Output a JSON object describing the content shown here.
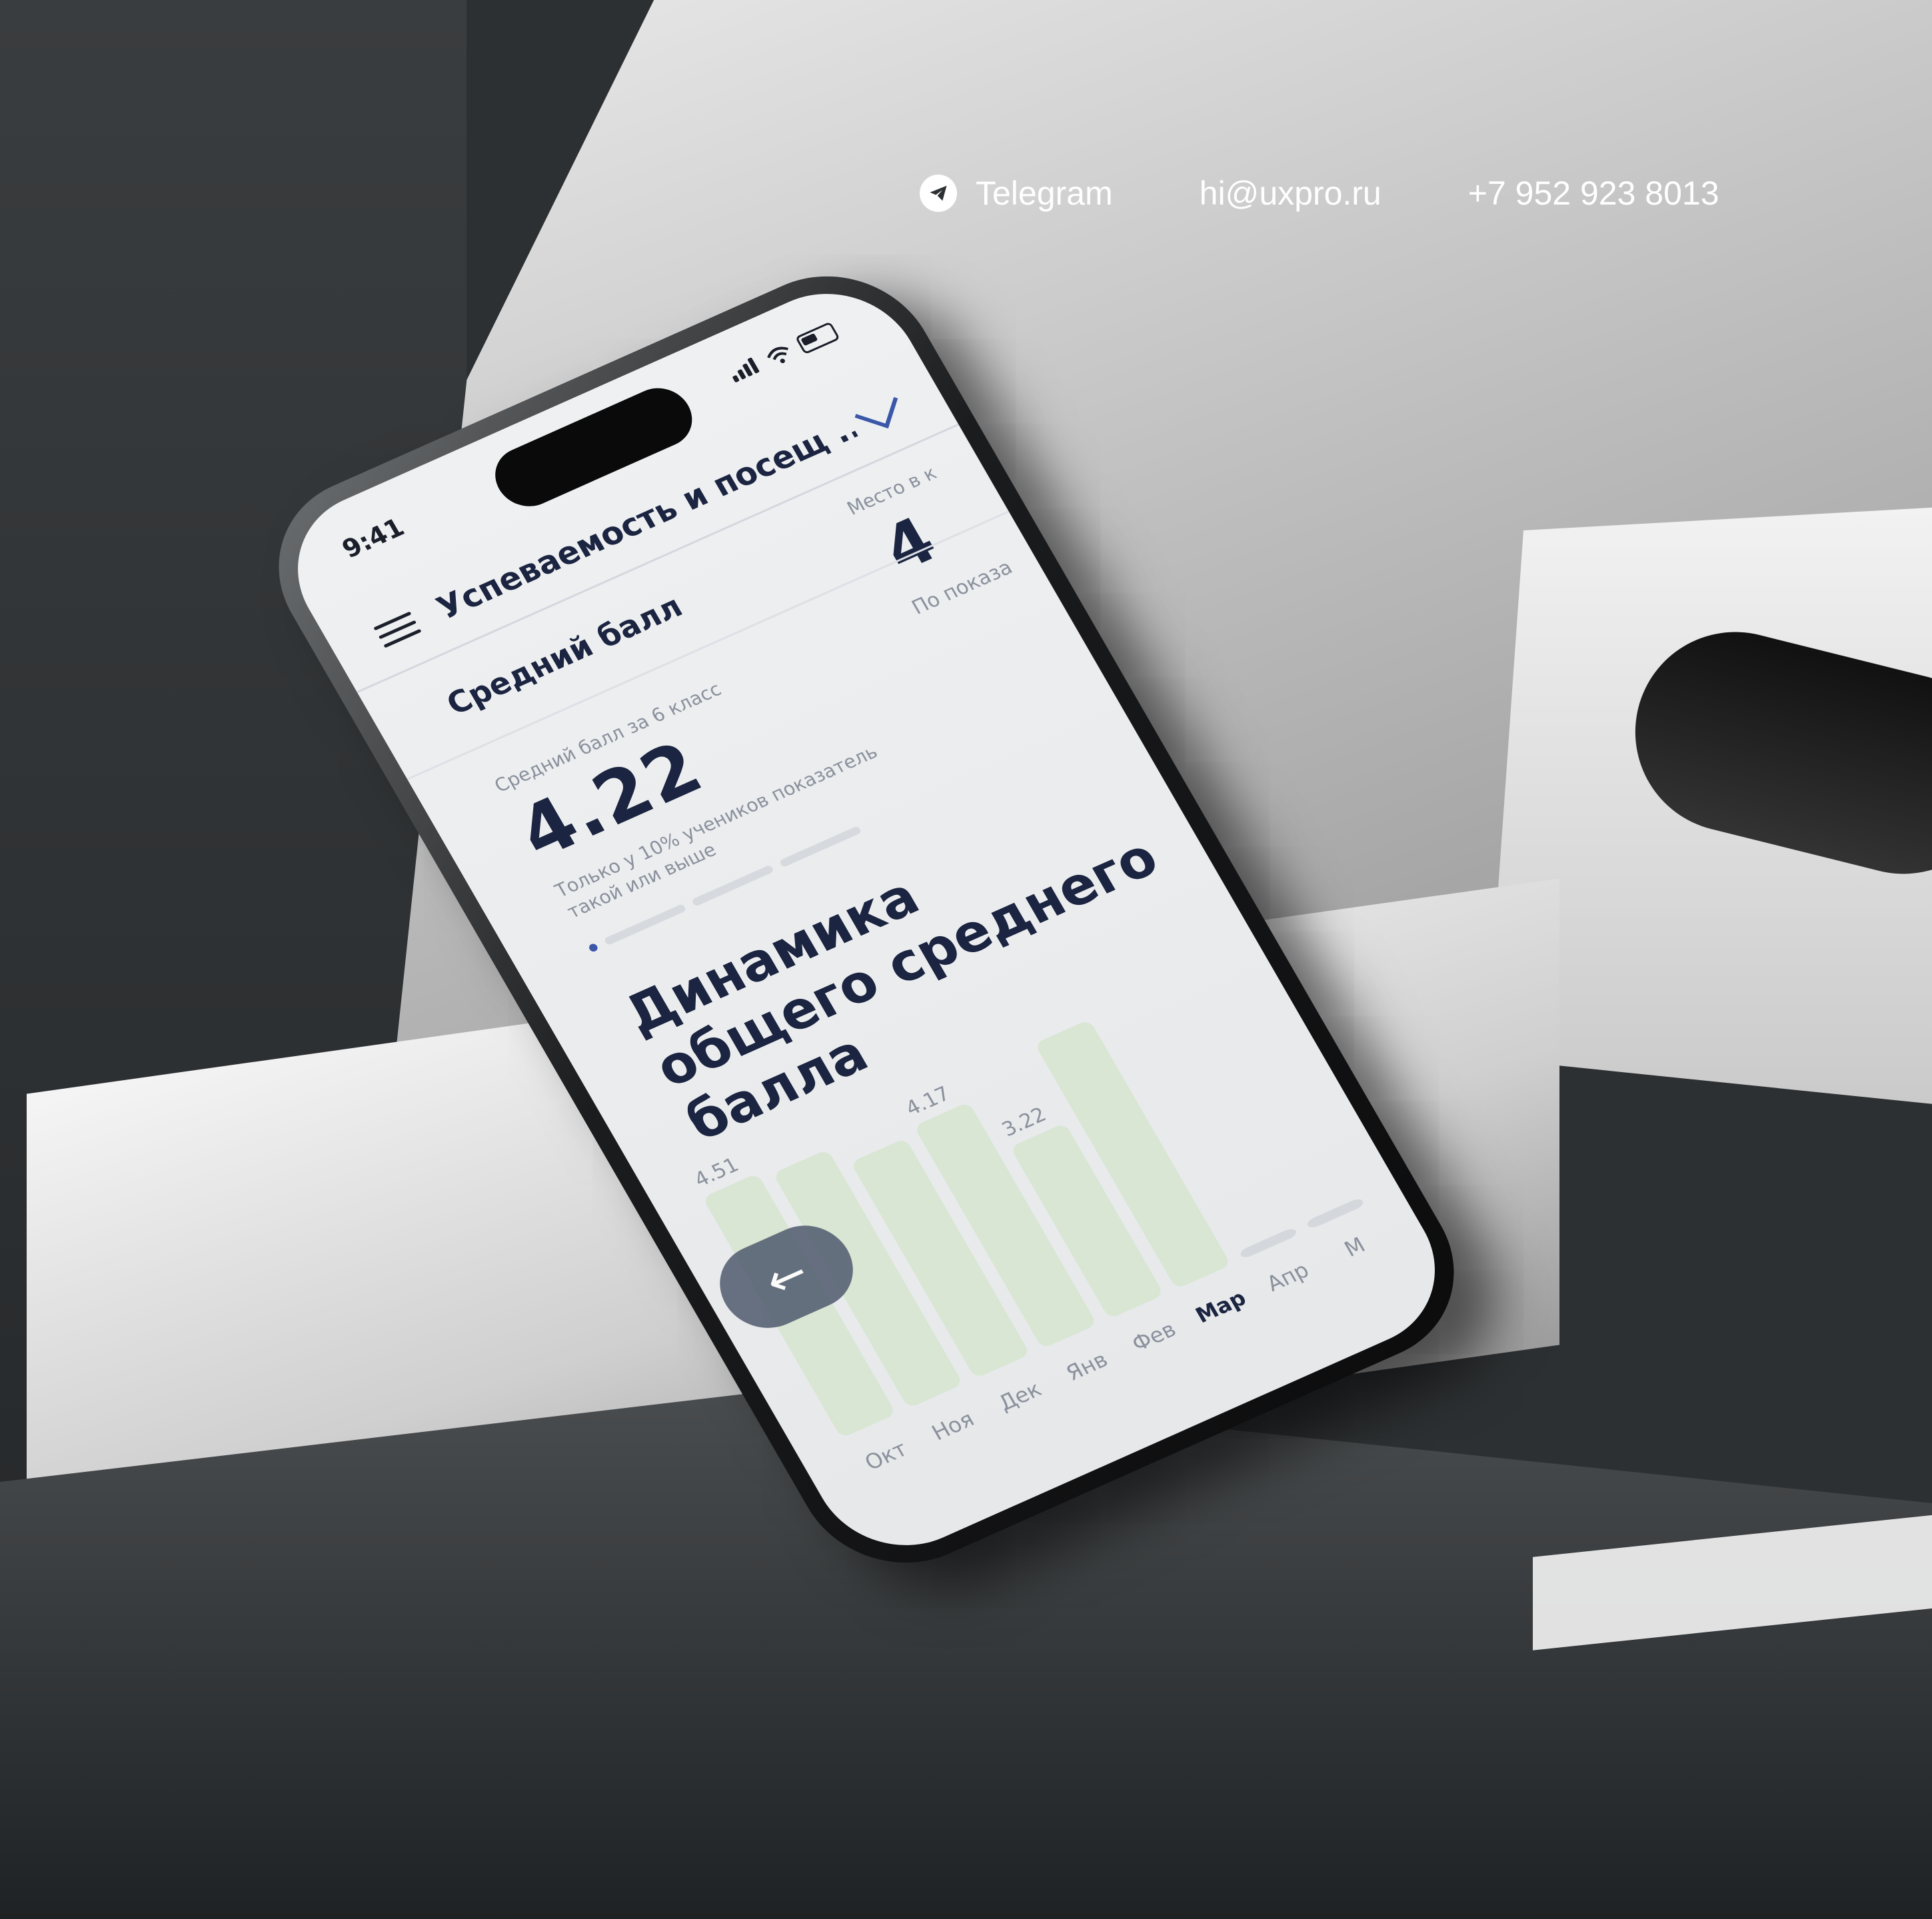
{
  "contacts": {
    "telegram_label": "Telegram",
    "telegram_icon": "telegram-plane-icon",
    "email": "hi@uxpro.ru",
    "phone": "+7 952 923 8013"
  },
  "phone": {
    "status": {
      "time": "9:41"
    },
    "header": {
      "title": "Успеваемость и посещ ...",
      "menu_icon": "hamburger-menu-icon",
      "dropdown_icon": "chevron-down-icon"
    },
    "average": {
      "section_title": "Средний балл",
      "label": "Средний балл за 6 класс",
      "value": "4.22",
      "note": "Только у 10% учеников показатель такой или выше",
      "progress": {
        "segments": 3,
        "active": 0
      }
    },
    "place": {
      "label": "Место в к",
      "value": "4",
      "note": "По показа"
    },
    "chart_title": "Динамика общего среднего балла",
    "back_icon": "arrow-left-icon",
    "back_symbol": "←"
  },
  "chart_data": {
    "type": "bar",
    "title": "Динамика общего среднего балла",
    "categories": [
      "Окт",
      "Ноя",
      "Дек",
      "Янв",
      "Фев",
      "Мар",
      "Апр",
      "М"
    ],
    "values": [
      4.51,
      4.4,
      4.05,
      4.17,
      3.22,
      4.6,
      0.1,
      0.1
    ],
    "data_labels": [
      "4.51",
      "",
      "",
      "4.17",
      "3.22",
      "",
      "",
      ""
    ],
    "highlight": "Мар",
    "bar_color": "#d9e6d3",
    "empty_bar_color": "#d4d8dd",
    "ylim": [
      0,
      5
    ]
  }
}
